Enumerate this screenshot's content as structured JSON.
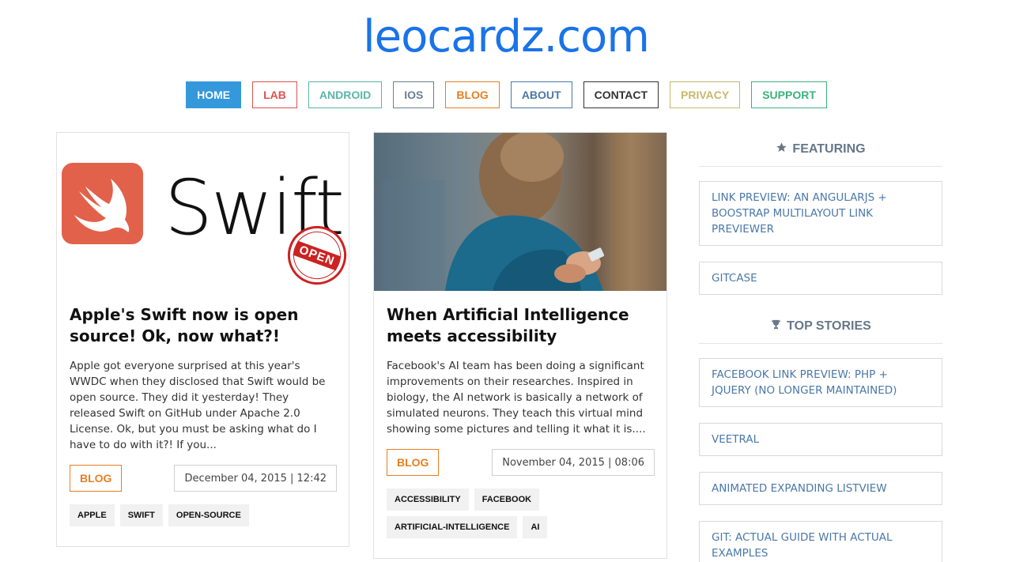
{
  "site": {
    "logo": "leocardz.com"
  },
  "nav": [
    {
      "label": "HOME",
      "color": "#3498db",
      "active": true
    },
    {
      "label": "LAB",
      "color": "#d9534f",
      "active": false
    },
    {
      "label": "ANDROID",
      "color": "#5bb5a8",
      "active": false
    },
    {
      "label": "IOS",
      "color": "#6a7f96",
      "active": false
    },
    {
      "label": "BLOG",
      "color": "#e67e22",
      "active": false
    },
    {
      "label": "ABOUT",
      "color": "#4a78a8",
      "active": false
    },
    {
      "label": "CONTACT",
      "color": "#333333",
      "active": false
    },
    {
      "label": "PRIVACY",
      "color": "#c8b86a",
      "active": false
    },
    {
      "label": "SUPPORT",
      "color": "#3bb27a",
      "active": false
    }
  ],
  "posts": [
    {
      "image_text": "Swift",
      "stamp_text": "OPEN",
      "title": "Apple's Swift now is open source! Ok, now what?!",
      "excerpt": "Apple got everyone surprised at this year's WWDC when they disclosed that Swift would be open source. They did it yesterday! They released Swift on GitHub under Apache 2.0 License. Ok, but you must be asking what do I have to do with it?! If you...",
      "category": "BLOG",
      "date": "December 04, 2015 | 12:42",
      "tags": [
        "APPLE",
        "SWIFT",
        "OPEN-SOURCE"
      ]
    },
    {
      "title": "When Artificial Intelligence meets accessibility",
      "excerpt": "Facebook's AI team has been doing a significant improvements on their researches. Inspired in biology, the AI network is basically a network of simulated neurons. They teach this virtual mind showing some pictures and telling it what it is....",
      "category": "BLOG",
      "date": "November 04, 2015 | 08:06",
      "tags": [
        "ACCESSIBILITY",
        "FACEBOOK",
        "ARTIFICIAL-INTELLIGENCE",
        "AI"
      ]
    }
  ],
  "sidebar": {
    "featuring": {
      "title": "FEATURING",
      "icon": "star-icon",
      "items": [
        "LINK PREVIEW: AN ANGULARJS + BOOSTRAP MULTILAYOUT LINK PREVIEWER",
        "GITCASE"
      ]
    },
    "top_stories": {
      "title": "TOP STORIES",
      "icon": "trophy-icon",
      "items": [
        "FACEBOOK LINK PREVIEW: PHP + JQUERY (NO LONGER MAINTAINED)",
        "VEETRAL",
        "ANIMATED EXPANDING LISTVIEW",
        "GIT: ACTUAL GUIDE WITH ACTUAL EXAMPLES"
      ]
    }
  },
  "colors": {
    "brand": "#1a73e8",
    "swift_orange": "#e2614a",
    "stamp_red": "#cc2222",
    "link": "#4a78a8"
  }
}
